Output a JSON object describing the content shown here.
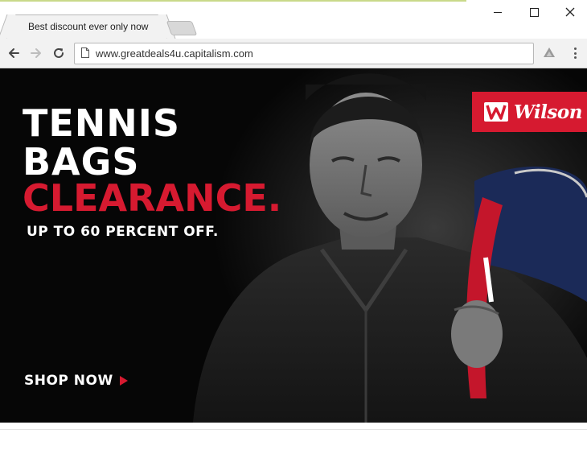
{
  "browser": {
    "tab_title": "Best discount ever only now",
    "url": "www.greatdeals4u.capitalism.com",
    "controls": {
      "minimize": "minimize-icon",
      "maximize": "maximize-icon",
      "close": "close-icon"
    },
    "nav_icons": [
      "back-arrow-icon",
      "forward-arrow-icon",
      "reload-icon"
    ],
    "toolbar_icons": [
      "page-icon",
      "extension-icon",
      "menu-icon"
    ]
  },
  "ad": {
    "headline_line1": "TENNIS",
    "headline_line2": "BAGS",
    "headline_line3": "CLEARANCE.",
    "subline": "UP TO 60 PERCENT OFF.",
    "cta": "SHOP NOW",
    "brand": "Wilson",
    "colors": {
      "accent_red": "#d61a30",
      "background": "#060606",
      "text": "#ffffff"
    }
  }
}
